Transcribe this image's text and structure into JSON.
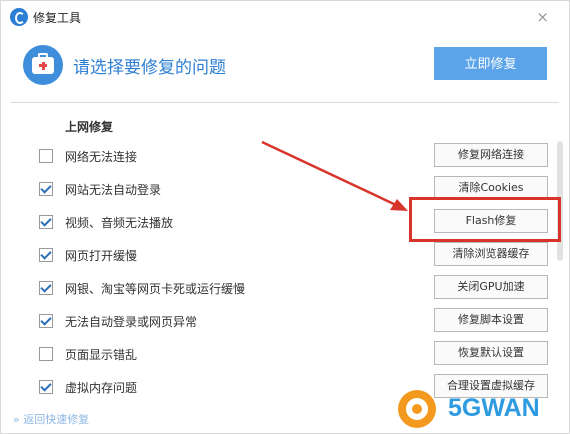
{
  "window": {
    "title": "修复工具",
    "close_glyph": "×"
  },
  "header": {
    "heading": "请选择要修复的问题",
    "fix_now_label": "立即修复"
  },
  "section": {
    "title": "上网修复"
  },
  "rows": [
    {
      "label": "网络无法连接",
      "checked": false,
      "action": "修复网络连接"
    },
    {
      "label": "网站无法自动登录",
      "checked": true,
      "action": "清除Cookies"
    },
    {
      "label": "视频、音频无法播放",
      "checked": true,
      "action": "Flash修复"
    },
    {
      "label": "网页打开缓慢",
      "checked": true,
      "action": "清除浏览器缓存"
    },
    {
      "label": "网银、淘宝等网页卡死或运行缓慢",
      "checked": true,
      "action": "关闭GPU加速"
    },
    {
      "label": "无法自动登录或网页异常",
      "checked": true,
      "action": "修复脚本设置"
    },
    {
      "label": "页面显示错乱",
      "checked": false,
      "action": "恢复默认设置"
    },
    {
      "label": "虚拟内存问题",
      "checked": true,
      "action": "合理设置虚拟缓存"
    }
  ],
  "footer": {
    "back_link": "» 返回快速修复"
  },
  "watermark": {
    "text": "5GWAN"
  },
  "colors": {
    "accent": "#2d7fd2",
    "button_blue": "#5ba4ea",
    "highlight_red": "#d9342b",
    "watermark_orange": "#f39a1e",
    "watermark_blue": "#2e9be0"
  }
}
